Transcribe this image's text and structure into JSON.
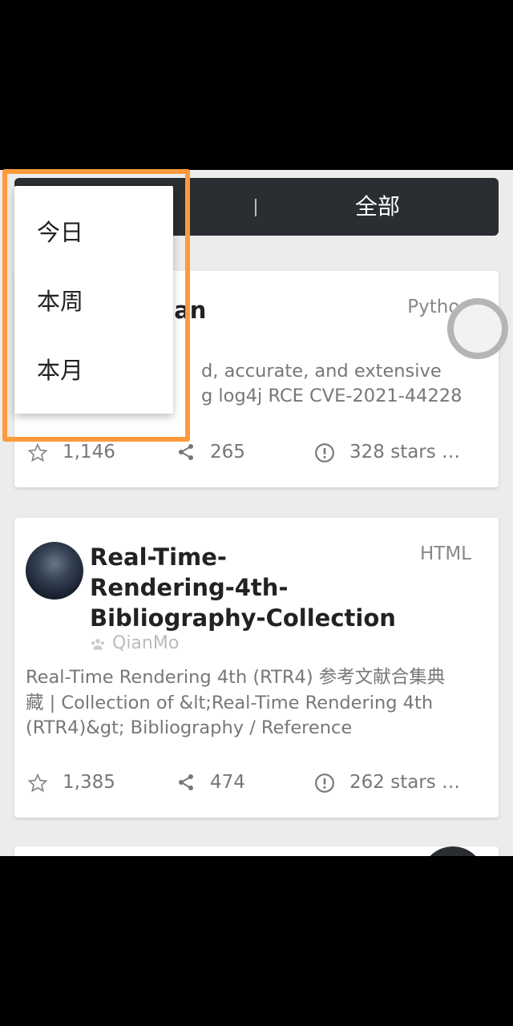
{
  "filter": {
    "all_label": "全部"
  },
  "dropdown": {
    "items": [
      {
        "label": "今日"
      },
      {
        "label": "本周"
      },
      {
        "label": "本月"
      }
    ]
  },
  "repos": [
    {
      "title_visible": "can",
      "language": "Python",
      "description_line1": "d, accurate, and extensive",
      "description_line2": "g log4j RCE CVE-2021-44228",
      "stars": "1,146",
      "forks": "265",
      "issues": "328 stars …"
    },
    {
      "title_line1": "Real-Time-",
      "title_line2": "Rendering-4th-",
      "title_line3": "Bibliography-Collection",
      "owner": "QianMo",
      "language": "HTML",
      "description_line1": "Real-Time Rendering 4th (RTR4) 参考文献合集典",
      "description_line2": "藏 | Collection of &lt;Real-Time Rendering 4th",
      "description_line3": "(RTR4)&gt; Bibliography / Reference",
      "stars": "1,385",
      "forks": "474",
      "issues": "262 stars …"
    }
  ],
  "colors": {
    "highlight": "#ff9a3c",
    "filter_bar": "#2a2d31",
    "background": "#ececec"
  },
  "icons": [
    "star-icon",
    "share-icon",
    "alert-circle-icon",
    "user-group-icon",
    "loading-spinner"
  ]
}
